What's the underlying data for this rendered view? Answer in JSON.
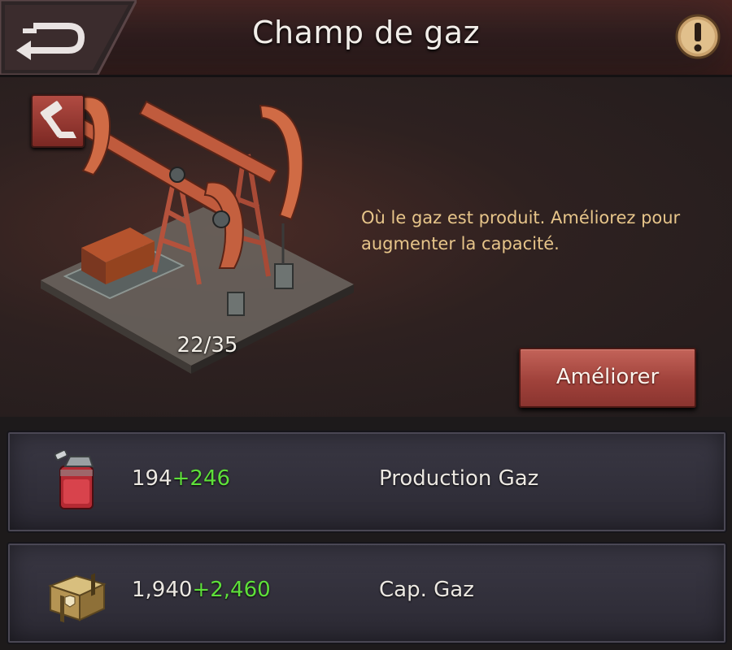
{
  "header": {
    "title": "Champ de gaz",
    "back_icon": "back-arrow-icon",
    "info_icon": "exclamation-icon"
  },
  "building": {
    "level_text": "22/35",
    "description": "Où le gaz est produit. Améliorez pour augmenter la capacité.",
    "upgrade_label": "Améliorer",
    "build_icon": "hammer-icon",
    "image": "gas-pumpjack-building"
  },
  "stats": [
    {
      "icon": "gas-canister-icon",
      "base": "194",
      "bonus": "+246",
      "label": "Production Gaz"
    },
    {
      "icon": "supply-crate-icon",
      "base": "1,940",
      "bonus": "+2,460",
      "label": "Cap. Gaz"
    }
  ],
  "colors": {
    "bonus_green": "#5ee03a",
    "description_gold": "#e7c58a",
    "upgrade_red": "#a0423b"
  }
}
